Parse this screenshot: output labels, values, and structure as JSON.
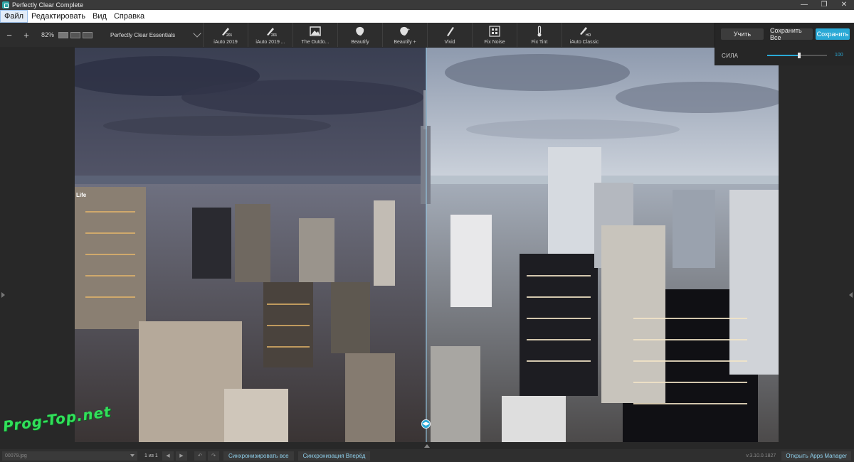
{
  "window": {
    "title": "Perfectly Clear Complete",
    "controls": [
      "—",
      "❐",
      "✕"
    ]
  },
  "menu": [
    "Файл",
    "Редактировать",
    "Вид",
    "Справка"
  ],
  "toolbar": {
    "zoom_out": "−",
    "zoom_in": "+",
    "zoom_level": "82%",
    "preset_group": "Perfectly Clear Essentials",
    "presets": [
      "iAuto 2019",
      "iAuto 2019 ...",
      "The Outdo...",
      "Beautify",
      "Beautify +",
      "Vivid",
      "Fix Noise",
      "Fix Tint",
      "iAuto Classic"
    ]
  },
  "panel": {
    "learn_btn": "Учить",
    "save_all_btn": "Сохранить Все",
    "save_btn": "Сохранить",
    "strength_label": "СИЛА",
    "strength_value": "100",
    "strength_fraction": 0.53
  },
  "canvas": {
    "split_handle": "◀▶",
    "building_sign": "Life"
  },
  "status": {
    "filename": "00079.jpg",
    "page": "1 из 1",
    "sync_all": "Синхронизировать все",
    "sync_forward": "Синхронизация Вперёд",
    "version": "v.3.10.0.1827",
    "open_apps": "Открыть Apps Manager"
  },
  "watermark": "Prog-Top.net",
  "colors": {
    "accent": "#2aa9d6",
    "toolbar": "#2d2d2d",
    "menubar": "#ffffff",
    "watermark": "#31e05a"
  }
}
